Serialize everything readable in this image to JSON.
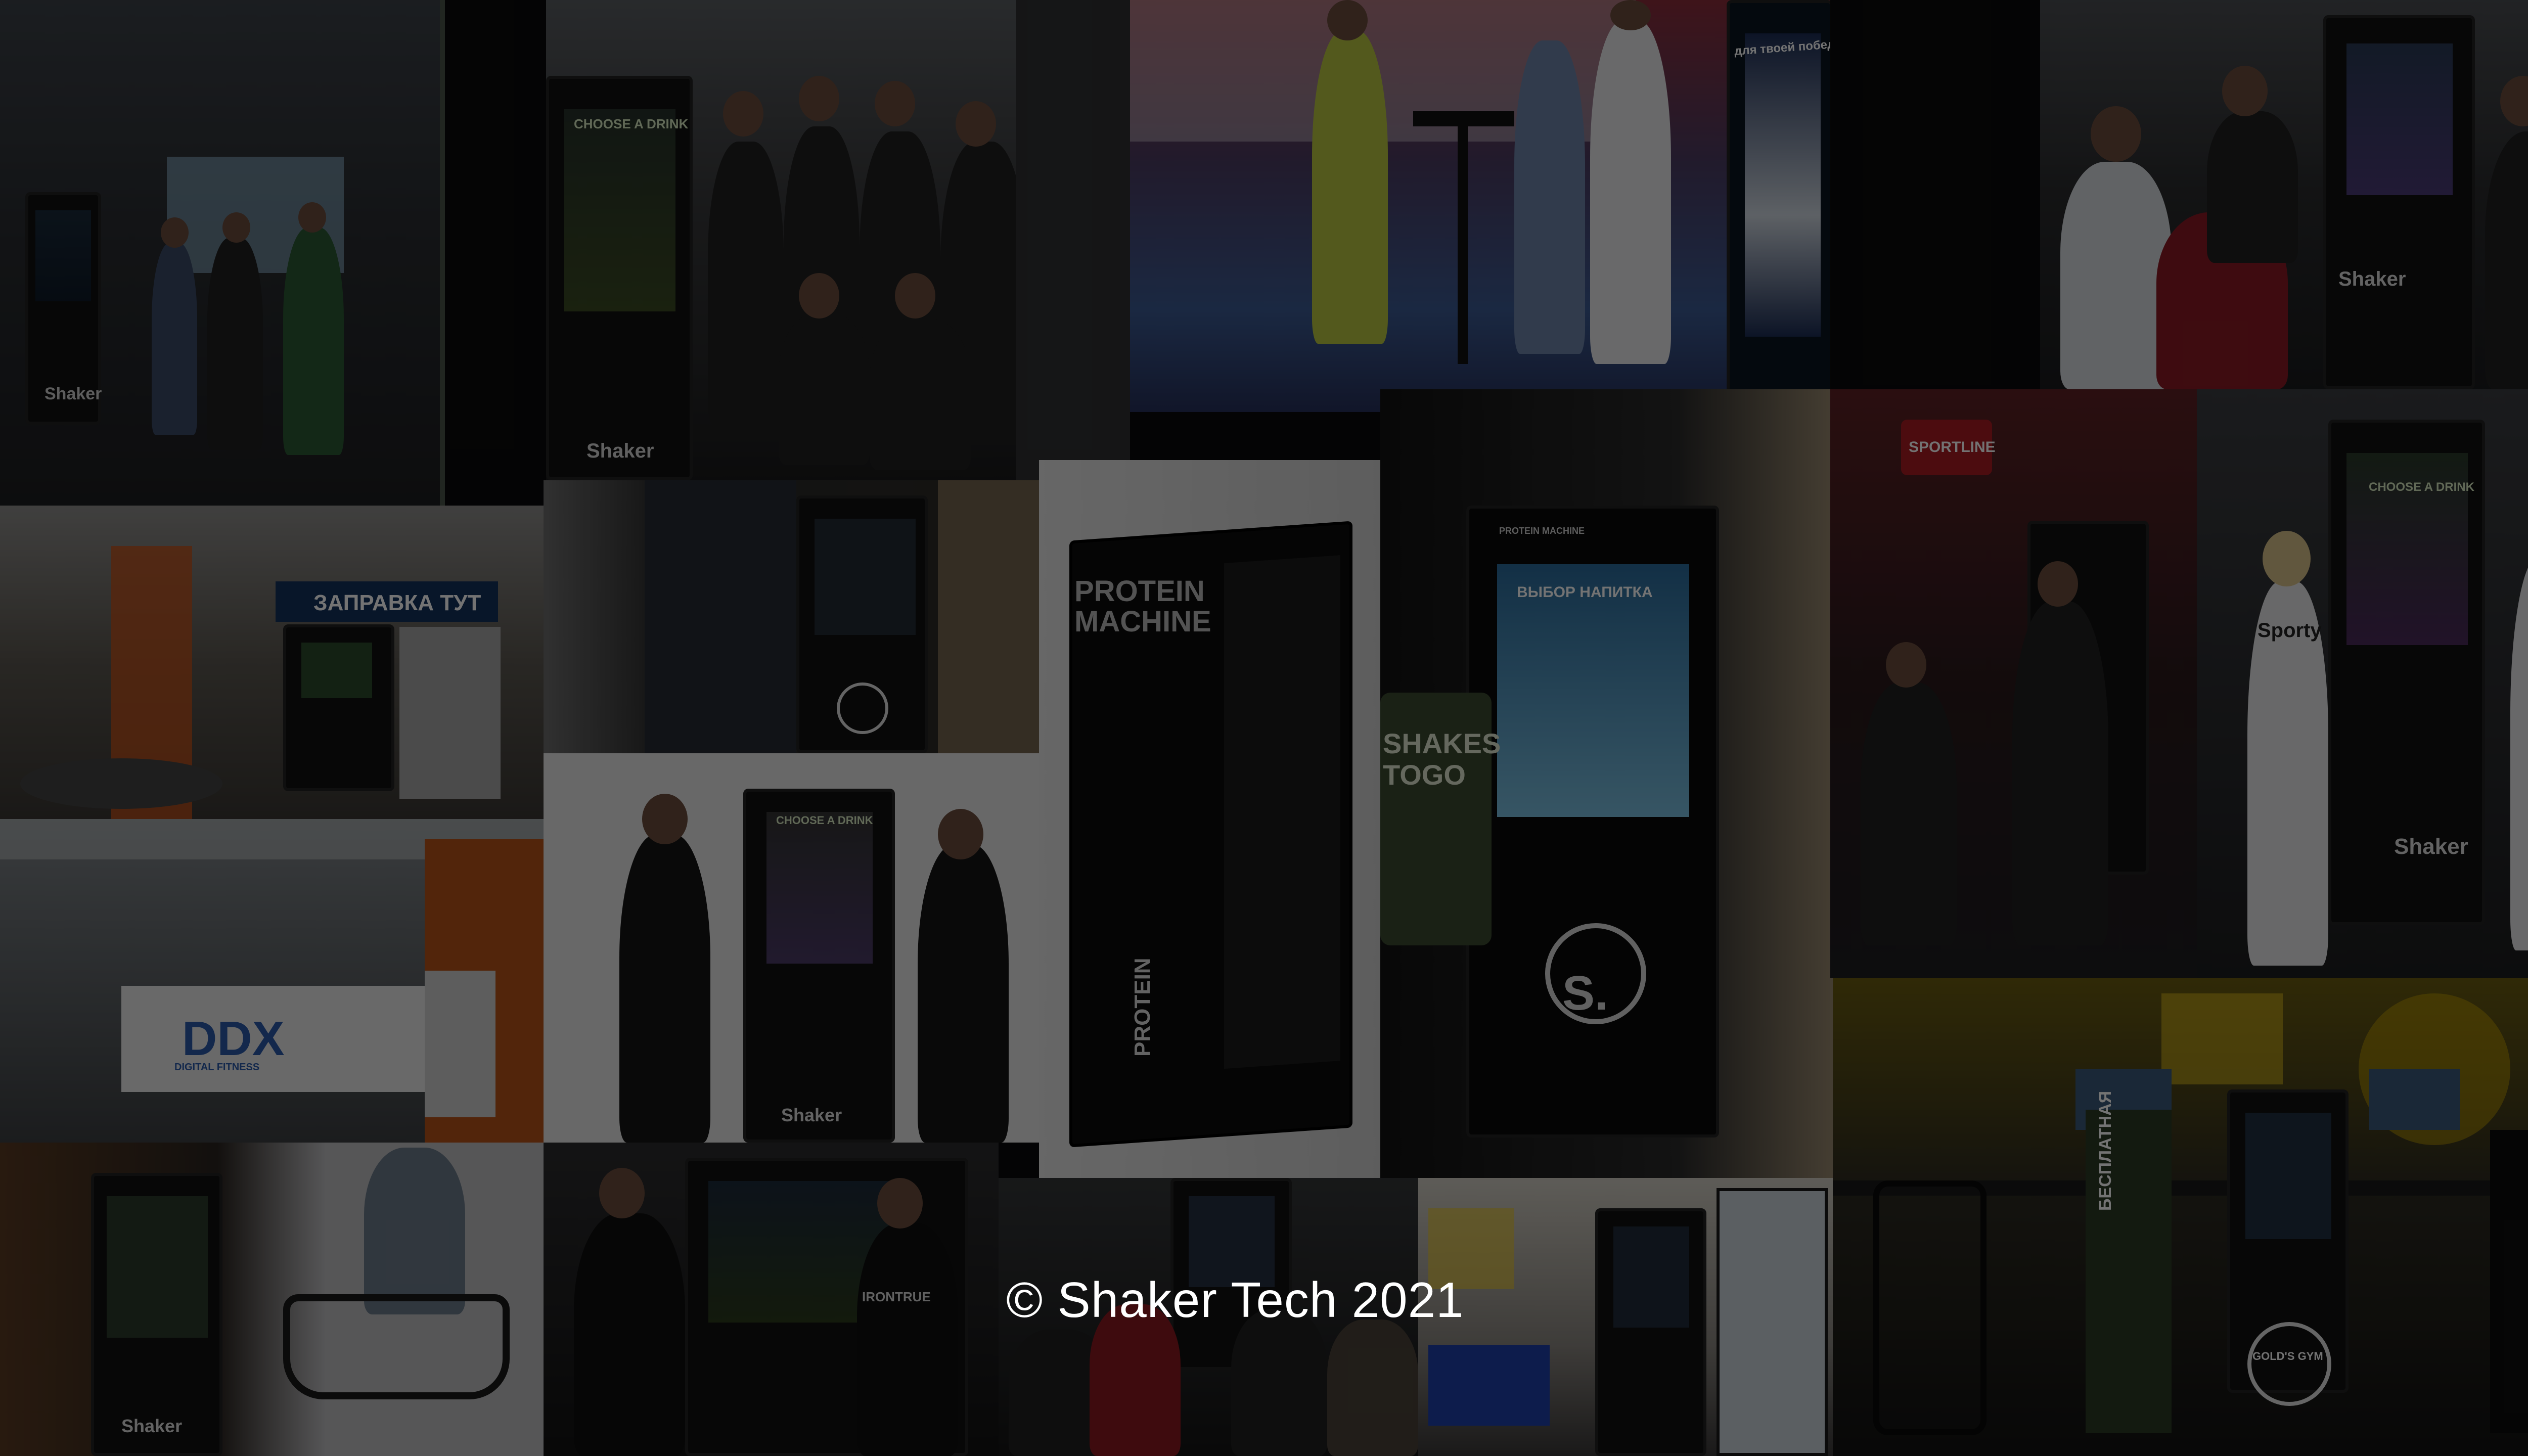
{
  "scene": {
    "description_label": "Shaker Tech vending machines photo collage",
    "overlay_color": "#000000"
  },
  "photo_texts": {
    "t1_brand": "Shaker",
    "t2_choose": "CHOOSE A DRINK",
    "t2_brand": "Shaker",
    "t3_sign": "для твоей победы!",
    "t4_brand": "Shaker",
    "t5_sign": "ЗАПРАВКА ТУТ",
    "t8_title": "PROTEIN MACHINE",
    "t8_footer": "PROTEIN",
    "t9_header": "PROTEIN MACHINE",
    "t9_screen": "ВЫБОР НАПИТКА",
    "t9_can": "SHAKES TOGO",
    "t9_logo": "S.",
    "t10_sign": "SPORTLINE",
    "t11_choose": "CHOOSE A DRINK",
    "t11_shirt": "Sporty",
    "t11_brand": "Shaker",
    "t12_logo": "DDX",
    "t12_sub": "DIGITAL FITNESS",
    "t13_choose": "CHOOSE A DRINK",
    "t13_brand": "Shaker",
    "t15_shirt": "IRONTRUE",
    "t16_brand": "Shaker",
    "t17_banner": "БЕСПЛАТНАЯ",
    "t17_gym": "GOLD'S GYM"
  },
  "copyright": "© Shaker Tech 2021"
}
